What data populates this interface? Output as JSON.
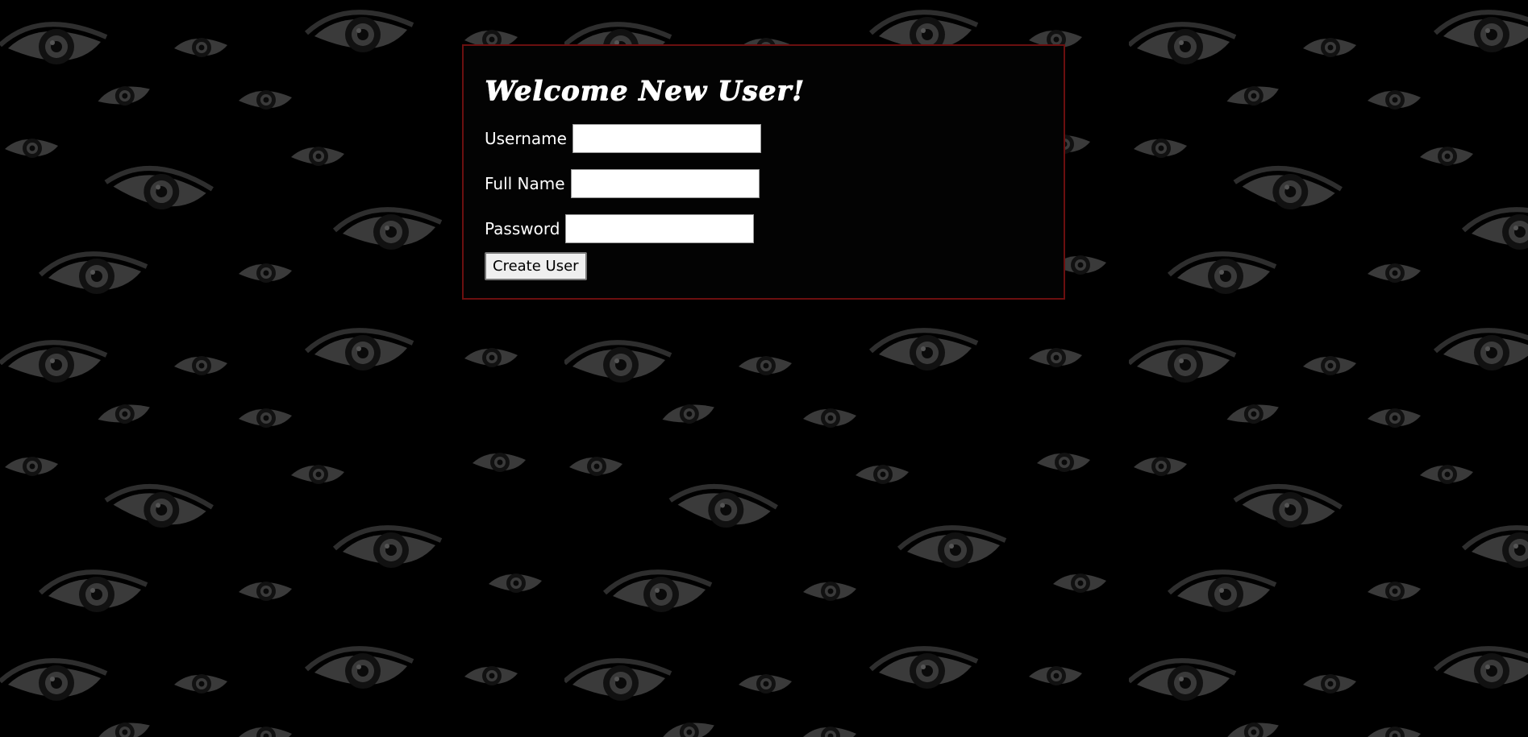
{
  "page": {
    "title": "Welcome New User!"
  },
  "form": {
    "username_label": "Username",
    "username_value": "",
    "fullname_label": "Full Name",
    "fullname_value": "",
    "password_label": "Password",
    "password_value": "",
    "submit_label": "Create User"
  },
  "theme": {
    "background": "#000000",
    "panel_background": "#030303",
    "panel_border": "#6b0f0f",
    "pattern_color": "#3a3a3a",
    "pattern_icon": "eye-icon"
  }
}
